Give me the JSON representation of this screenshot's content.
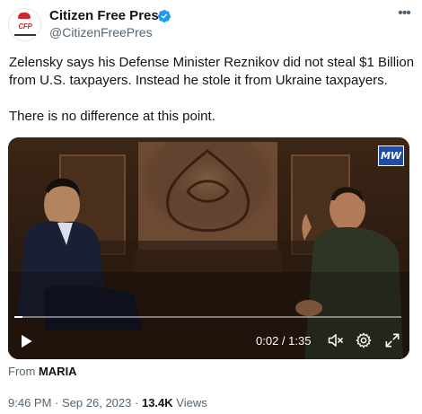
{
  "author": {
    "display_name": "Citizen Free Press",
    "handle": "@CitizenFreePres",
    "avatar_text": "CFP"
  },
  "tweet": {
    "line1": "Zelensky says his Defense Minister Reznikov did not steal $1 Billion from U.S. taxpayers. Instead he stole it from Ukraine taxpayers.",
    "line2": "There is no difference at this point."
  },
  "video": {
    "watermark": "MW",
    "time": "0:02 / 1:35",
    "progress_fraction": 0.02,
    "controls": [
      "play-icon",
      "volume-muted-icon",
      "settings-gear-icon",
      "fullscreen-icon"
    ]
  },
  "source": {
    "from_label": "From",
    "from_name": "MARIA"
  },
  "meta": {
    "time": "9:46 PM",
    "separator": "·",
    "date": "Sep 26, 2023",
    "views_count": "13.4K",
    "views_label": "Views"
  },
  "colors": {
    "text": "#0f1419",
    "secondary": "#536471",
    "verified": "#1d9bf0"
  }
}
